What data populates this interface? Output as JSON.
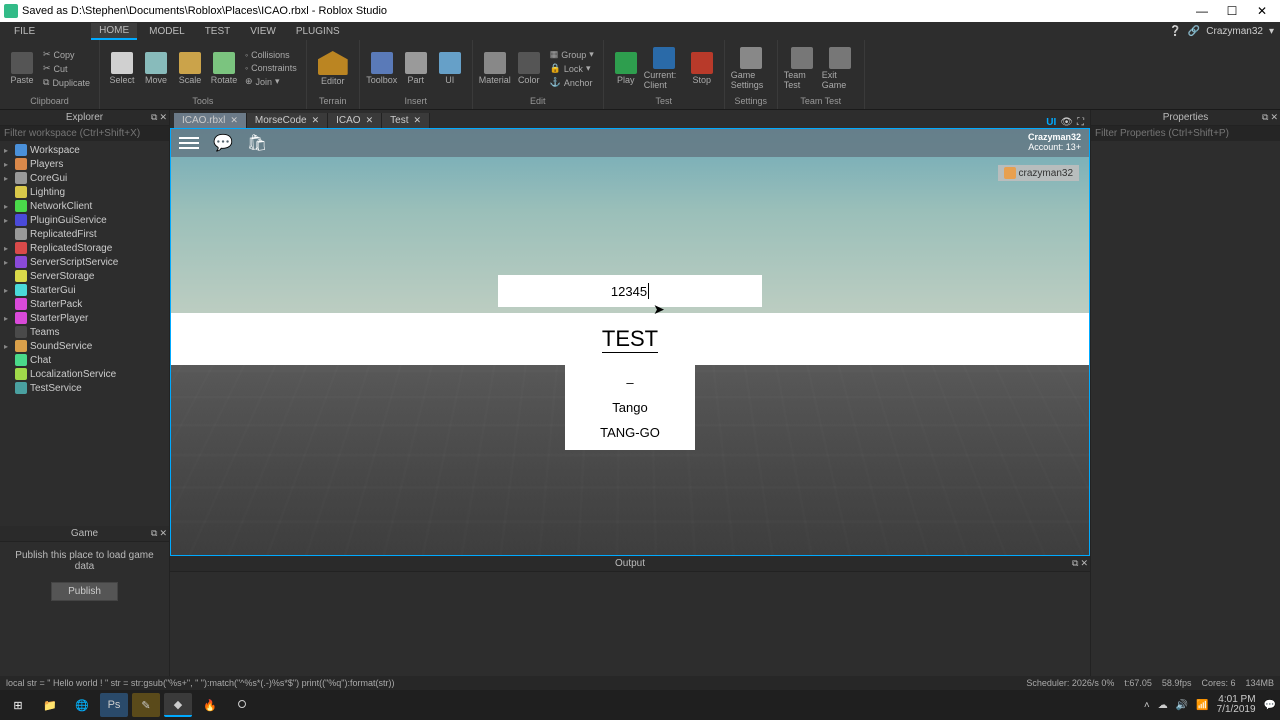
{
  "title_bar": {
    "text": "Saved as D:\\Stephen\\Documents\\Roblox\\Places\\ICAO.rbxl - Roblox Studio"
  },
  "menu": {
    "file": "FILE",
    "tabs": [
      "HOME",
      "MODEL",
      "TEST",
      "VIEW",
      "PLUGINS"
    ],
    "share": "Share",
    "user": "Crazyman32"
  },
  "ribbon": {
    "clipboard": {
      "paste": "Paste",
      "copy": "Copy",
      "cut": "Cut",
      "duplicate": "Duplicate",
      "label": "Clipboard"
    },
    "tools": {
      "select": "Select",
      "move": "Move",
      "scale": "Scale",
      "rotate": "Rotate",
      "collisions": "Collisions",
      "constraints": "Constraints",
      "join": "Join",
      "label": "Tools"
    },
    "terrain": {
      "editor": "Editor",
      "terrain": "Terrain",
      "label": "Terrain"
    },
    "insert": {
      "toolbox": "Toolbox",
      "part": "Part",
      "ui": "UI",
      "label": "Insert"
    },
    "edit": {
      "material": "Material",
      "color": "Color",
      "group": "Group",
      "lock": "Lock",
      "anchor": "Anchor",
      "label": "Edit"
    },
    "test": {
      "play": "Play",
      "client": "Current: Client",
      "stop": "Stop",
      "label": "Test"
    },
    "settings": {
      "game": "Game Settings",
      "label": "Settings"
    },
    "teamtest": {
      "team": "Team Test",
      "exit": "Exit Game",
      "label": "Team Test"
    }
  },
  "explorer": {
    "title": "Explorer",
    "filter_placeholder": "Filter workspace (Ctrl+Shift+X)",
    "items": [
      {
        "label": "Workspace",
        "cls": "t-wk",
        "exp": true
      },
      {
        "label": "Players",
        "cls": "t-pl",
        "exp": true
      },
      {
        "label": "CoreGui",
        "cls": "t-cg",
        "exp": true
      },
      {
        "label": "Lighting",
        "cls": "t-li",
        "exp": false
      },
      {
        "label": "NetworkClient",
        "cls": "t-nc",
        "exp": true
      },
      {
        "label": "PluginGuiService",
        "cls": "t-ps",
        "exp": true
      },
      {
        "label": "ReplicatedFirst",
        "cls": "t-rf",
        "exp": false
      },
      {
        "label": "ReplicatedStorage",
        "cls": "t-rs",
        "exp": true
      },
      {
        "label": "ServerScriptService",
        "cls": "t-ss",
        "exp": true
      },
      {
        "label": "ServerStorage",
        "cls": "t-st",
        "exp": false
      },
      {
        "label": "StarterGui",
        "cls": "t-sg",
        "exp": true
      },
      {
        "label": "StarterPack",
        "cls": "t-sp",
        "exp": false
      },
      {
        "label": "StarterPlayer",
        "cls": "t-sp",
        "exp": true
      },
      {
        "label": "Teams",
        "cls": "t-tm",
        "exp": false
      },
      {
        "label": "SoundService",
        "cls": "t-snd",
        "exp": true
      },
      {
        "label": "Chat",
        "cls": "t-ch",
        "exp": false
      },
      {
        "label": "LocalizationService",
        "cls": "t-loc",
        "exp": false
      },
      {
        "label": "TestService",
        "cls": "t-ts",
        "exp": false
      }
    ]
  },
  "game_panel": {
    "title": "Game",
    "message": "Publish this place to load game data",
    "publish": "Publish"
  },
  "properties": {
    "title": "Properties",
    "filter_placeholder": "Filter Properties (Ctrl+Shift+P)"
  },
  "doc_tabs": [
    {
      "label": "ICAO.rbxl",
      "active": true
    },
    {
      "label": "MorseCode",
      "active": false
    },
    {
      "label": "ICAO",
      "active": false
    },
    {
      "label": "Test",
      "active": false
    }
  ],
  "right_icons": {
    "ui": "UI",
    "eye": "👁"
  },
  "viewport": {
    "user": "Crazyman32",
    "account": "Account: 13+",
    "player": "crazyman32",
    "input_value": "12345",
    "big_label": "TEST",
    "dash": "–",
    "word": "Tango",
    "pron": "TANG-GO"
  },
  "output": {
    "title": "Output"
  },
  "status": {
    "left": "local str = \"    Hello    world   !    \" str = str:gsub(\"%s+\", \" \"):match(\"^%s*(.-)%s*$\") print((\"%q\"):format(str))",
    "scheduler": "Scheduler: 2026/s 0%",
    "time": "t:67.05",
    "fps": "58.9fps",
    "cores": "Cores: 6",
    "mem": "134MB"
  },
  "taskbar": {
    "time": "4:01 PM",
    "date": "7/1/2019"
  }
}
